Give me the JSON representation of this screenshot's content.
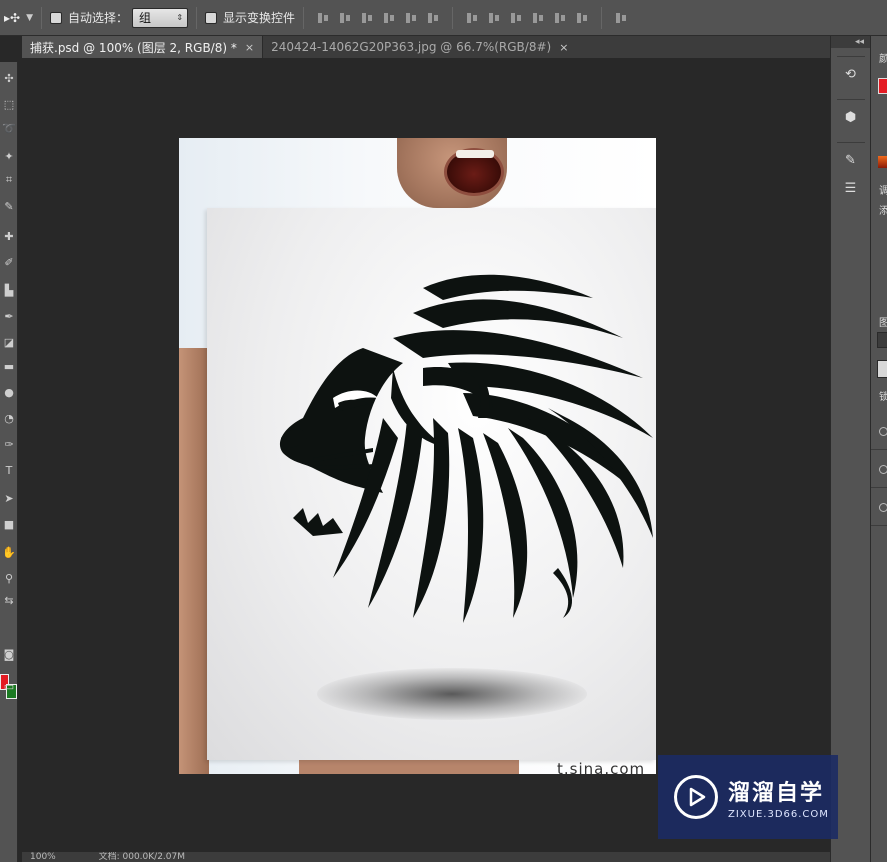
{
  "options_bar": {
    "move_tool_glyph": "▸✣",
    "auto_select_label": "自动选择：",
    "auto_select_value": "组",
    "show_transform_label": "显示变换控件"
  },
  "tabs": [
    {
      "label": "捕获.psd @ 100% (图层 2, RGB/8) *",
      "close": "×"
    },
    {
      "label": "240424-14062G20P363.jpg @ 66.7%(RGB/8#)",
      "close": "×"
    }
  ],
  "canvas": {
    "watermark_text": "t.sina.com"
  },
  "status_bar": {
    "zoom": "100%",
    "doc_info": "文档: 000.0K/2.07M"
  },
  "right_panel": {
    "collapse_arrows": "◂◂",
    "tab_letter_1": "颜",
    "tab_letter_2": "调",
    "tab_letter_3": "添",
    "tab_letter_4": "图",
    "tab_letter_5": "锁"
  },
  "watermark": {
    "title": "溜溜自学",
    "subtitle": "ZIXUE.3D66.COM"
  },
  "colors": {
    "foreground": "#e41b23",
    "background": "#1c7a23",
    "ui_panel": "#535353",
    "ui_dark": "#282828"
  }
}
